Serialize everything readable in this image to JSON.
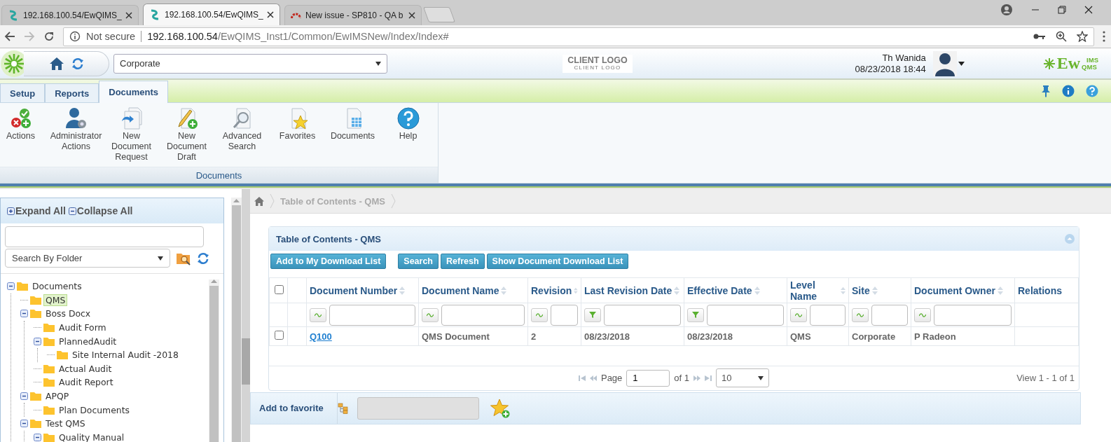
{
  "browser": {
    "tabs": [
      {
        "title": "192.168.100.54/EwQIMS_",
        "selected": false
      },
      {
        "title": "192.168.100.54/EwQIMS_",
        "selected": true
      },
      {
        "title": "New issue - SP810 - QA b",
        "selected": false
      }
    ],
    "address": {
      "security": "Not secure",
      "host": "192.168.100.54",
      "path": "/EwQIMS_Inst1/Common/EwIMSNew/Index/Index#"
    }
  },
  "header": {
    "company": "Corporate",
    "client_logo": {
      "title": "CLIENT LOGO",
      "subtitle": "CLIENT LOGO"
    },
    "user": {
      "name": "Th Wanida",
      "datetime": "08/23/2018 18:44"
    },
    "brand": {
      "name": "Ew",
      "upper": "IMS",
      "lower": "QMS"
    }
  },
  "ribbon_tabs": [
    {
      "label": "Setup",
      "selected": false
    },
    {
      "label": "Reports",
      "selected": false
    },
    {
      "label": "Documents",
      "selected": true
    }
  ],
  "ribbon": {
    "buttons": [
      {
        "label": "Actions"
      },
      {
        "label": "Administrator Actions"
      },
      {
        "label": "New Document Request"
      },
      {
        "label": "New Document Draft"
      },
      {
        "label": "Advanced Search"
      },
      {
        "label": "Favorites"
      },
      {
        "label": "Documents"
      },
      {
        "label": "Help"
      }
    ],
    "group": "Documents"
  },
  "sidebar": {
    "expand_all": "Expand All",
    "collapse_all": "Collapse All",
    "search_mode": "Search By Folder",
    "tree": [
      {
        "label": "Documents",
        "expanded": true,
        "selected": false,
        "children": [
          {
            "label": "QMS",
            "selected": true
          },
          {
            "label": "Boss Docx",
            "expanded": true,
            "selected": false,
            "children": [
              {
                "label": "Audit Form",
                "selected": false
              },
              {
                "label": "PlannedAudit",
                "expanded": true,
                "selected": false,
                "children": [
                  {
                    "label": "Site Internal Audit -2018",
                    "selected": false
                  }
                ]
              },
              {
                "label": "Actual Audit",
                "selected": false
              },
              {
                "label": "Audit Report",
                "selected": false
              }
            ]
          },
          {
            "label": "APQP",
            "expanded": true,
            "selected": false,
            "children": [
              {
                "label": "Plan Documents",
                "selected": false
              }
            ]
          },
          {
            "label": "Test QMS",
            "expanded": true,
            "selected": false,
            "children": [
              {
                "label": "Quality Manual",
                "expanded": true,
                "selected": false
              }
            ]
          }
        ]
      }
    ]
  },
  "breadcrumb": [
    "Table of Contents - QMS"
  ],
  "grid": {
    "title": "Table of Contents - QMS",
    "buttons": [
      {
        "label": "Add to My Download List"
      },
      {
        "label": "Search"
      },
      {
        "label": "Refresh"
      },
      {
        "label": "Show Document Download List"
      }
    ],
    "select_all": {
      "checked": false
    },
    "columns": [
      {
        "label": "Document Number",
        "sortable": true,
        "kind": "text"
      },
      {
        "label": "Document Name",
        "sortable": true,
        "kind": "text"
      },
      {
        "label": "Revision",
        "sortable": true,
        "kind": "text"
      },
      {
        "label": "Last Revision Date",
        "sortable": true,
        "kind": "date"
      },
      {
        "label": "Effective Date",
        "sortable": true,
        "kind": "date"
      },
      {
        "label": "Level Name",
        "sortable": true,
        "kind": "text"
      },
      {
        "label": "Site",
        "sortable": true,
        "kind": "text"
      },
      {
        "label": "Document Owner",
        "sortable": true,
        "kind": "text"
      },
      {
        "label": "Relations",
        "sortable": false,
        "kind": "plain"
      }
    ],
    "rows": [
      {
        "checked": false,
        "cells": [
          "Q100",
          "QMS Document",
          "2",
          "08/23/2018",
          "08/23/2018",
          "QMS",
          "Corporate",
          "P Radeon"
        ]
      }
    ],
    "pager": {
      "page_label": "Page",
      "page": "1",
      "page_count": "of 1",
      "page_size": "10",
      "summary": "View 1 - 1 of 1"
    }
  },
  "favorite": {
    "label": "Add to favorite",
    "field": {
      "disabled": true
    }
  }
}
